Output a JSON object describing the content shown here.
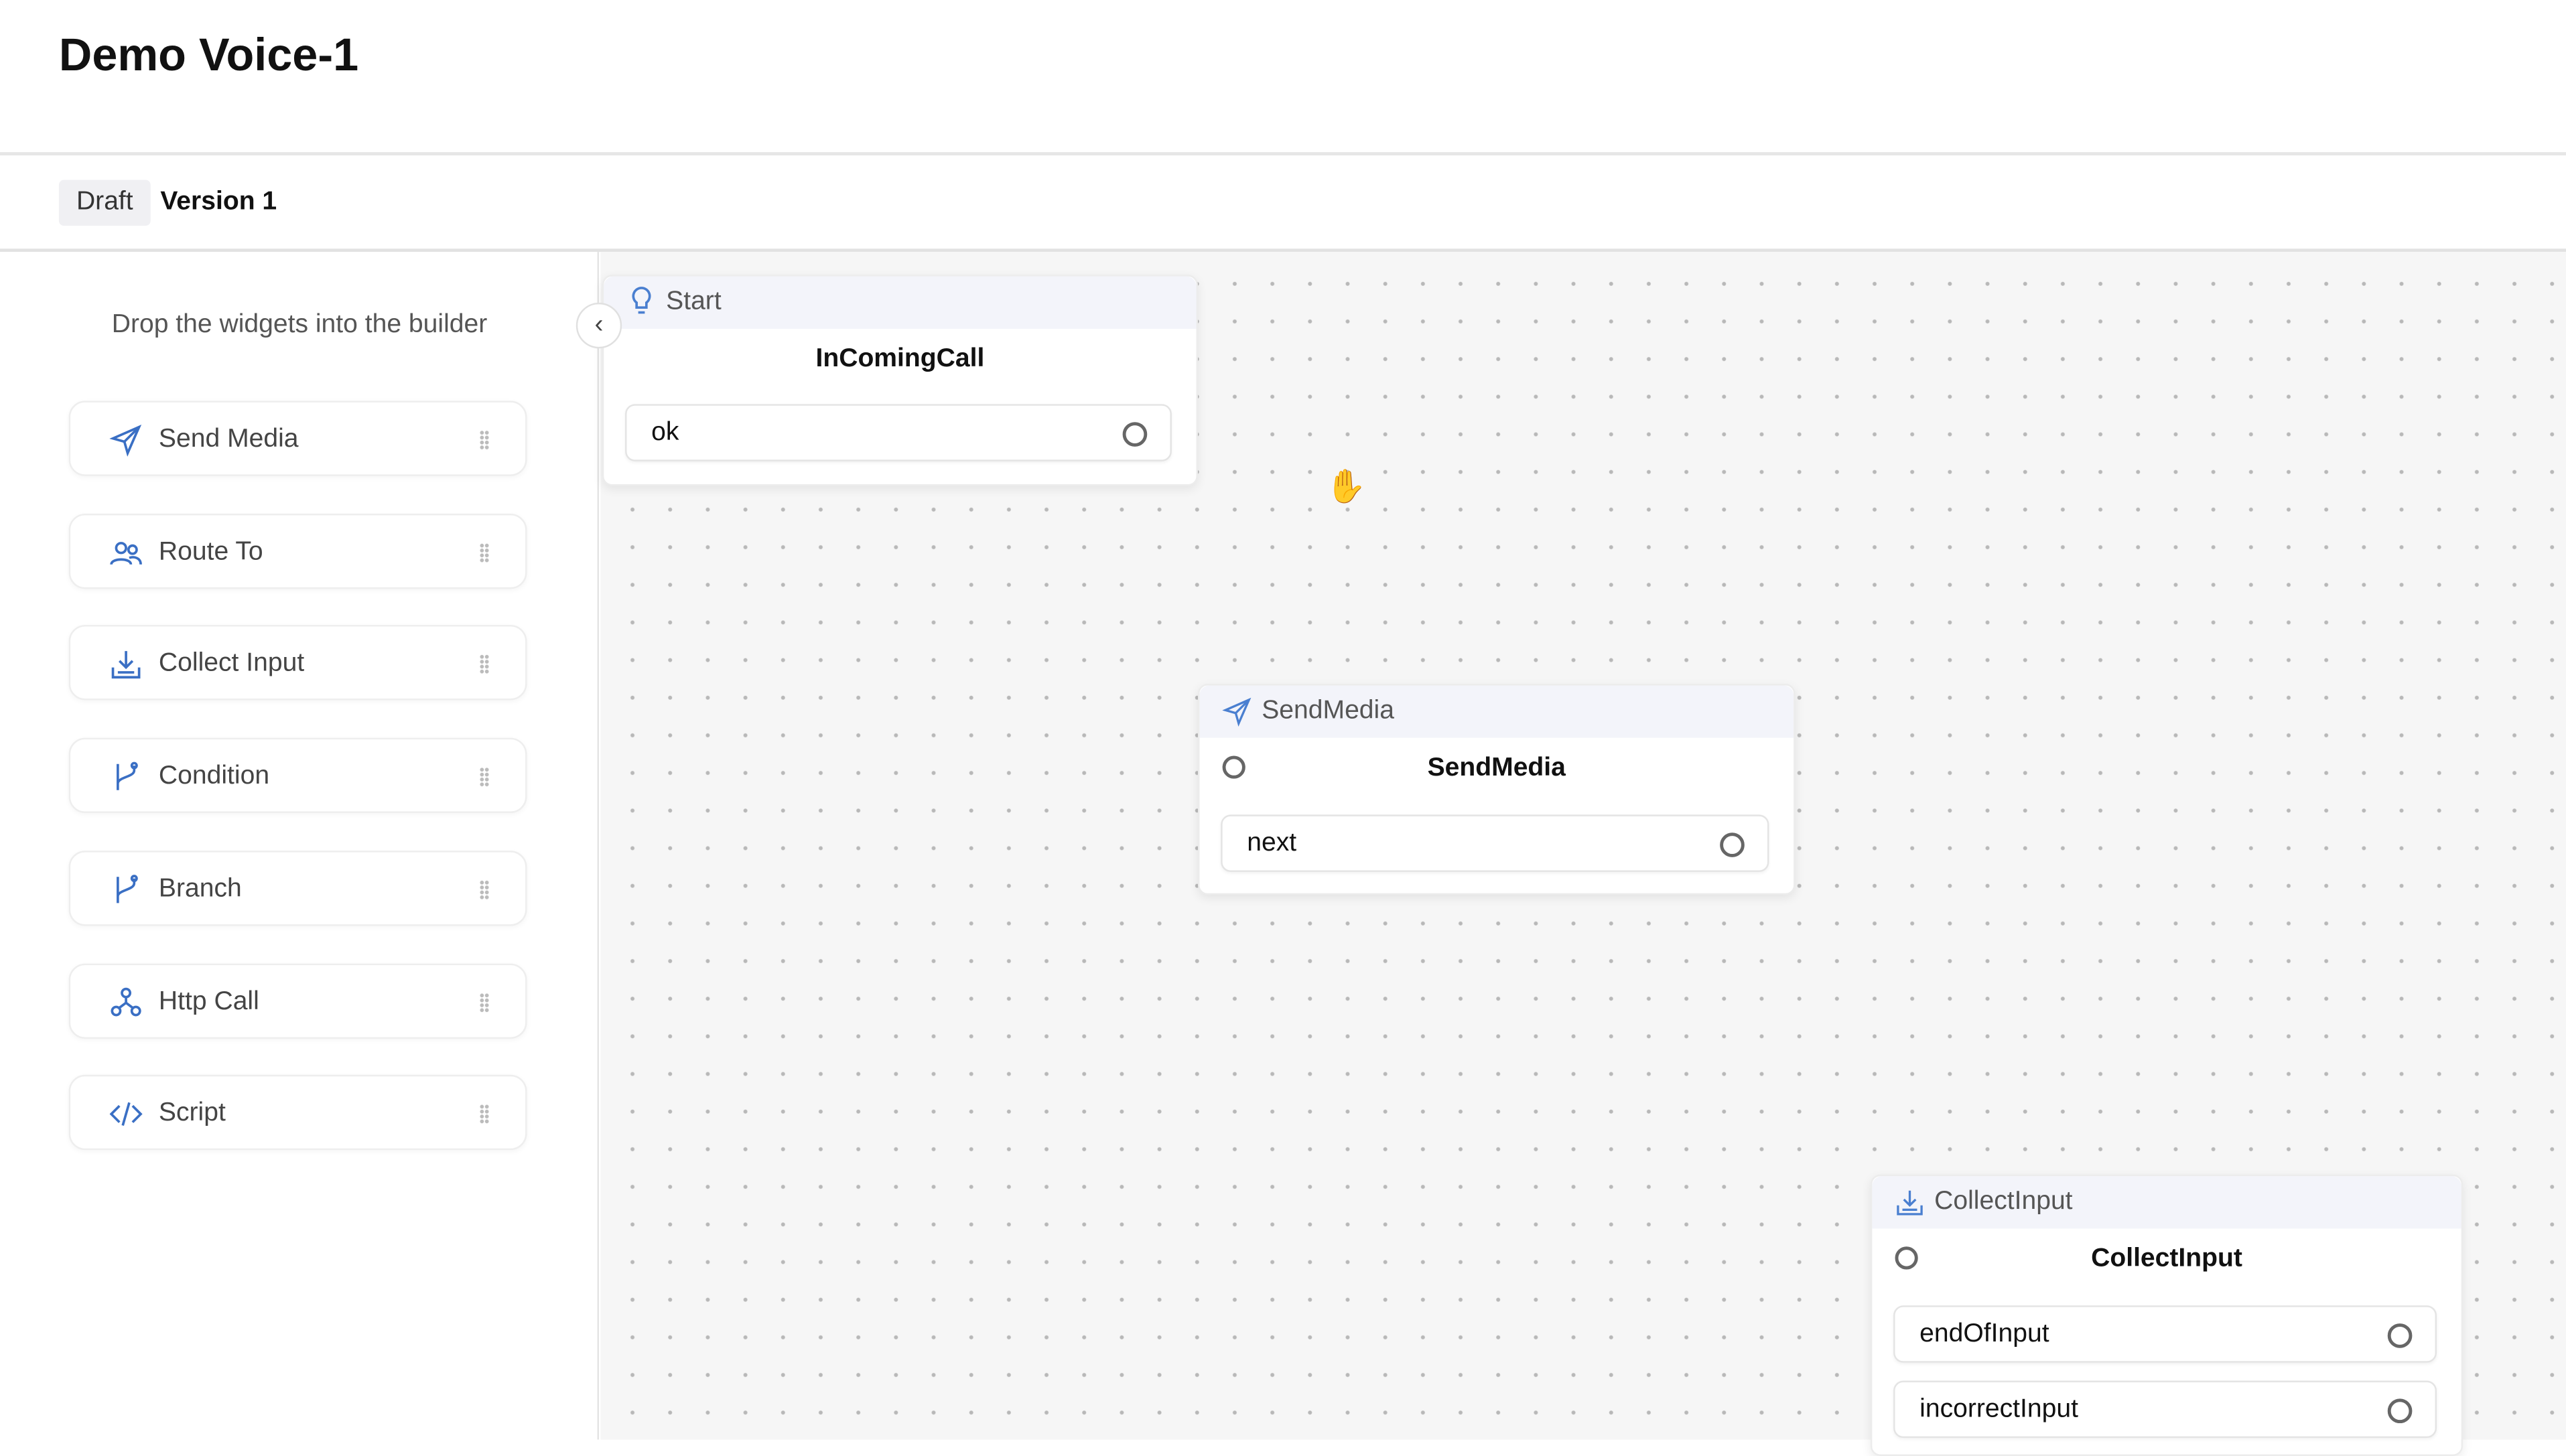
{
  "header": {
    "title": "Demo Voice-1"
  },
  "version_bar": {
    "status": "Draft",
    "version": "Version 1"
  },
  "sidebar": {
    "hint": "Drop the widgets into the builder",
    "widgets": [
      {
        "label": "Send Media",
        "icon": "send-icon"
      },
      {
        "label": "Route To",
        "icon": "users-icon"
      },
      {
        "label": "Collect Input",
        "icon": "collect-icon"
      },
      {
        "label": "Condition",
        "icon": "branch-icon"
      },
      {
        "label": "Branch",
        "icon": "branch-icon"
      },
      {
        "label": "Http Call",
        "icon": "network-icon"
      },
      {
        "label": "Script",
        "icon": "code-icon"
      }
    ]
  },
  "canvas": {
    "nodes": [
      {
        "type": "Start",
        "name": "InComingCall",
        "outputs": [
          "ok"
        ]
      },
      {
        "type": "SendMedia",
        "name": "SendMedia",
        "outputs": [
          "next"
        ]
      },
      {
        "type": "CollectInput",
        "name": "CollectInput",
        "outputs": [
          "endOfInput",
          "incorrectInput"
        ]
      }
    ]
  },
  "colors": {
    "accent": "#3a6fc4",
    "node_header": "#f3f4fa"
  }
}
